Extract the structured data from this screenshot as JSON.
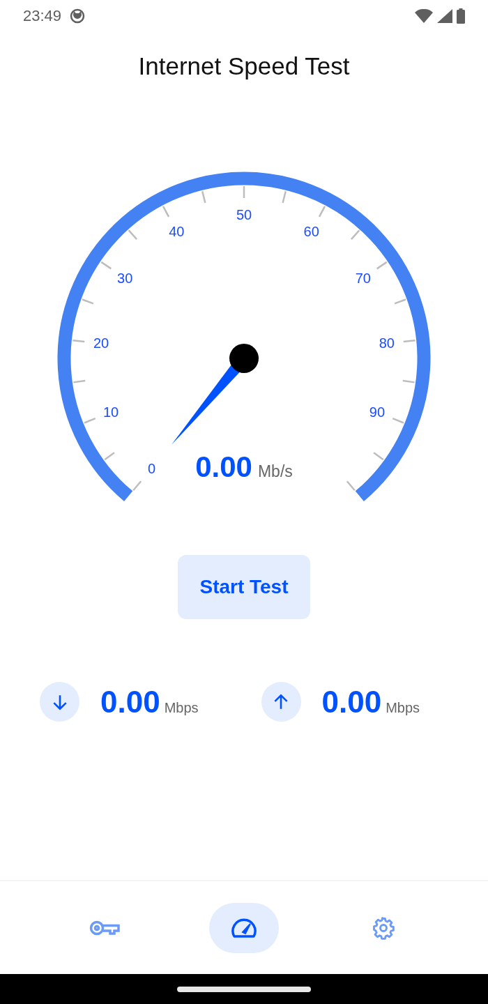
{
  "status_bar": {
    "time": "23:49"
  },
  "title": "Internet Speed Test",
  "gauge": {
    "scale_labels": [
      "0",
      "10",
      "20",
      "30",
      "40",
      "50",
      "60",
      "70",
      "80",
      "90"
    ],
    "reading": "0.00",
    "unit": "Mb/s"
  },
  "start_button": "Start Test",
  "stats": [
    {
      "kind": "download",
      "value": "0.00",
      "unit": "Mbps"
    },
    {
      "kind": "upload",
      "value": "0.00",
      "unit": "Mbps"
    }
  ],
  "nav": [
    {
      "kind": "key",
      "selected": false
    },
    {
      "kind": "gauge",
      "selected": true
    },
    {
      "kind": "settings",
      "selected": false
    }
  ]
}
